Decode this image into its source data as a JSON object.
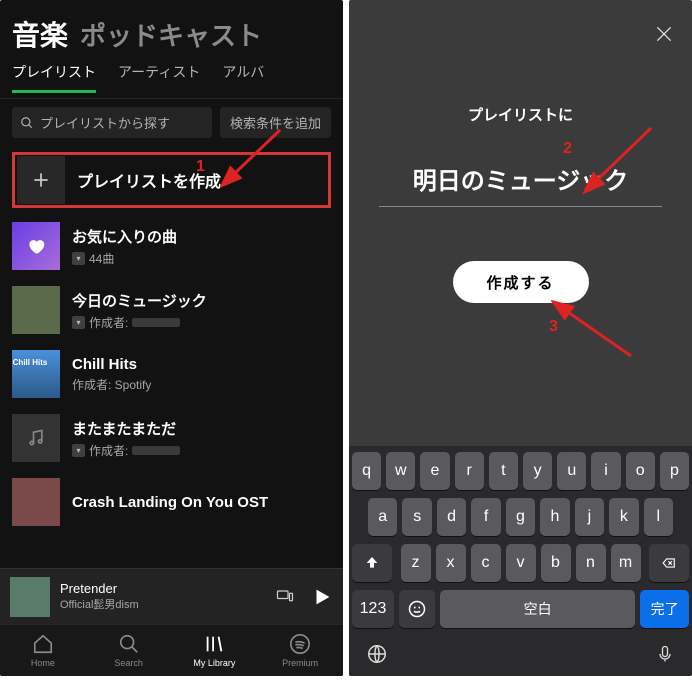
{
  "left": {
    "topTabs": {
      "music": "音楽",
      "podcast": "ポッドキャスト"
    },
    "filters": {
      "playlist": "プレイリスト",
      "artist": "アーティスト",
      "album": "アルバ"
    },
    "search": {
      "placeholder": "プレイリストから探す",
      "addCondition": "検索条件を追加"
    },
    "createRow": "プレイリストを作成",
    "items": [
      {
        "title": "お気に入りの曲",
        "sub": "44曲",
        "dl": true,
        "thumb": "fav"
      },
      {
        "title": "今日のミュージック",
        "sub": "作成者:",
        "dl": true,
        "mask": true,
        "thumb": "photo"
      },
      {
        "title": "Chill Hits",
        "sub": "作成者: Spotify",
        "thumb": "hits"
      },
      {
        "title": "またまたまただ",
        "sub": "作成者:",
        "dl": true,
        "mask": true,
        "thumb": "note"
      },
      {
        "title": "Crash Landing On You OST",
        "sub": "",
        "thumb": "photo2"
      }
    ],
    "nowPlaying": {
      "title": "Pretender",
      "artist": "Official髭男dism"
    },
    "nav": {
      "home": "Home",
      "search": "Search",
      "library": "My Library",
      "premium": "Premium"
    }
  },
  "right": {
    "prompt": "プレイリストに",
    "name": "明日のミュージック",
    "createBtn": "作成する",
    "keys": {
      "row1": [
        "q",
        "w",
        "e",
        "r",
        "t",
        "y",
        "u",
        "i",
        "o",
        "p"
      ],
      "row2": [
        "a",
        "s",
        "d",
        "f",
        "g",
        "h",
        "j",
        "k",
        "l"
      ],
      "row3": [
        "z",
        "x",
        "c",
        "v",
        "b",
        "n",
        "m"
      ],
      "numKey": "123",
      "space": "空白",
      "done": "完了"
    }
  },
  "callouts": {
    "c1": "1",
    "c2": "2",
    "c3": "3"
  }
}
